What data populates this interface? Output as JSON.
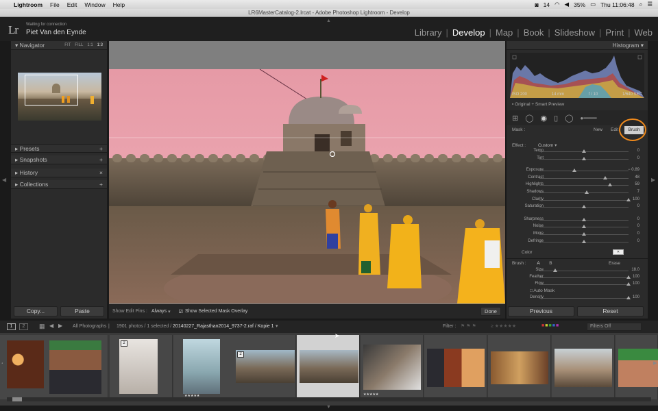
{
  "menubar": {
    "app": "Lightroom",
    "items": [
      "File",
      "Edit",
      "Window",
      "Help"
    ],
    "status_right": [
      "14",
      "35%",
      "Thu 11:06:48"
    ]
  },
  "titlebar": {
    "title": "LR6MasterCatalog-2.lrcat - Adobe Photoshop Lightroom - Develop"
  },
  "identity": {
    "logo": "Lr",
    "status": "Waiting for connection",
    "user": "Piet Van den Eynde"
  },
  "modules": {
    "items": [
      "Library",
      "Develop",
      "Map",
      "Book",
      "Slideshow",
      "Print",
      "Web"
    ],
    "active": "Develop"
  },
  "left_panel": {
    "navigator": {
      "title": "Navigator",
      "zoom_options": [
        "FIT",
        "FILL",
        "1:1",
        "1:3"
      ]
    },
    "sections": [
      {
        "label": "Presets",
        "action": "+"
      },
      {
        "label": "Snapshots",
        "action": "+"
      },
      {
        "label": "History",
        "action": "×"
      },
      {
        "label": "Collections",
        "action": "+"
      }
    ],
    "copy_label": "Copy...",
    "paste_label": "Paste"
  },
  "right_panel": {
    "histogram": {
      "title": "Histogram",
      "info": [
        "ISO 200",
        "14 mm",
        "f / 10",
        "1/640 SEC"
      ],
      "preview_note": "Original + Smart Preview"
    },
    "mask": {
      "label": "Mask :",
      "new": "New",
      "edit": "Edit",
      "brush": "Brush"
    },
    "effect": {
      "label": "Effect :",
      "value": "Custom"
    },
    "sliders": [
      {
        "label": "Temp",
        "value": "0",
        "pos": 0.5,
        "group": 1
      },
      {
        "label": "Tint",
        "value": "0",
        "pos": 0.5,
        "group": 1
      },
      {
        "label": "Exposure",
        "value": "− 0.89",
        "pos": 0.39,
        "group": 2
      },
      {
        "label": "Contrast",
        "value": "48",
        "pos": 0.74,
        "group": 2
      },
      {
        "label": "Highlights",
        "value": "59",
        "pos": 0.79,
        "group": 2
      },
      {
        "label": "Shadows",
        "value": "7",
        "pos": 0.53,
        "group": 2
      },
      {
        "label": "Clarity",
        "value": "100",
        "pos": 1.0,
        "group": 2
      },
      {
        "label": "Saturation",
        "value": "0",
        "pos": 0.5,
        "group": 2
      },
      {
        "label": "Sharpness",
        "value": "0",
        "pos": 0.5,
        "group": 3
      },
      {
        "label": "Noise",
        "value": "0",
        "pos": 0.5,
        "group": 3
      },
      {
        "label": "Moire",
        "value": "0",
        "pos": 0.5,
        "group": 3
      },
      {
        "label": "Defringe",
        "value": "0",
        "pos": 0.5,
        "group": 3
      }
    ],
    "color_label": "Color",
    "brush": {
      "label": "Brush :",
      "a": "A",
      "b": "B",
      "erase": "Erase",
      "sliders": [
        {
          "label": "Size",
          "value": "18.0",
          "pos": 0.18
        },
        {
          "label": "Feather",
          "value": "100",
          "pos": 1.0
        },
        {
          "label": "Flow",
          "value": "100",
          "pos": 1.0
        }
      ],
      "auto_mask": "Auto Mask",
      "density": {
        "label": "Density",
        "value": "100",
        "pos": 1.0
      }
    },
    "previous_label": "Previous",
    "reset_label": "Reset"
  },
  "toolbar": {
    "show_edit_pins_label": "Show Edit Pins :",
    "show_edit_pins_value": "Always",
    "overlay_label": "Show Selected Mask Overlay",
    "done_label": "Done"
  },
  "filmstrip_bar": {
    "page1": "1",
    "page2": "2",
    "source": "All Photographs",
    "count": "1901 photos / 1 selected /",
    "filename": "20140227_Rajasthan2014_9737-2.raf / Kopie 1",
    "filter_label": "Filter :",
    "filter_value": "Filters Off"
  },
  "filmstrip": {
    "badges": [
      "2",
      "2"
    ],
    "stars": [
      "★★★★★",
      "★★★★★"
    ]
  },
  "colors": {
    "accent_circle": "#f08a1c",
    "mask_overlay": "#ff7a8a",
    "panel_bg": "#2b2b2b"
  }
}
